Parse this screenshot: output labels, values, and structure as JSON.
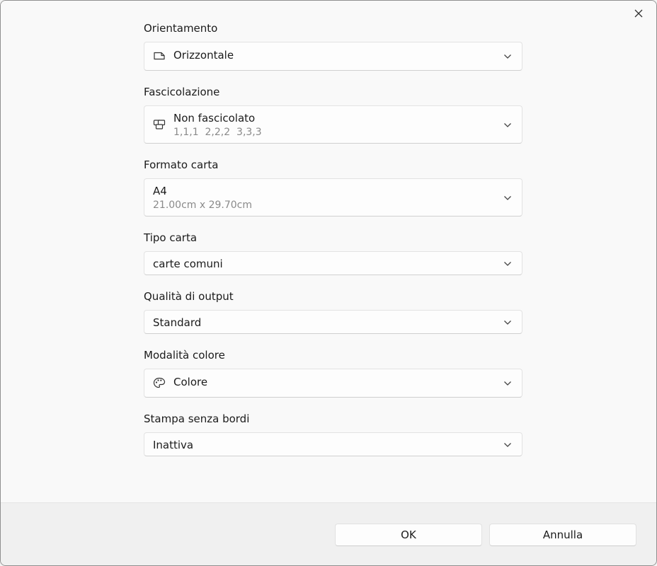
{
  "dialog": {
    "close_icon": "close-icon"
  },
  "fields": {
    "orientation": {
      "label": "Orientamento",
      "value": "Orizzontale",
      "icon": "landscape-page-icon"
    },
    "collation": {
      "label": "Fascicolazione",
      "value": "Non fascicolato",
      "detail": "1,1,1  2,2,2  3,3,3",
      "icon": "collate-pages-icon"
    },
    "paper_size": {
      "label": "Formato carta",
      "value": "A4",
      "detail": "21.00cm x 29.70cm"
    },
    "paper_type": {
      "label": "Tipo carta",
      "value": "carte comuni"
    },
    "output_quality": {
      "label": "Qualità di output",
      "value": "Standard"
    },
    "color_mode": {
      "label": "Modalità colore",
      "value": "Colore",
      "icon": "palette-icon"
    },
    "borderless": {
      "label": "Stampa senza bordi",
      "value": "Inattiva"
    }
  },
  "footer": {
    "ok_label": "OK",
    "cancel_label": "Annulla"
  }
}
